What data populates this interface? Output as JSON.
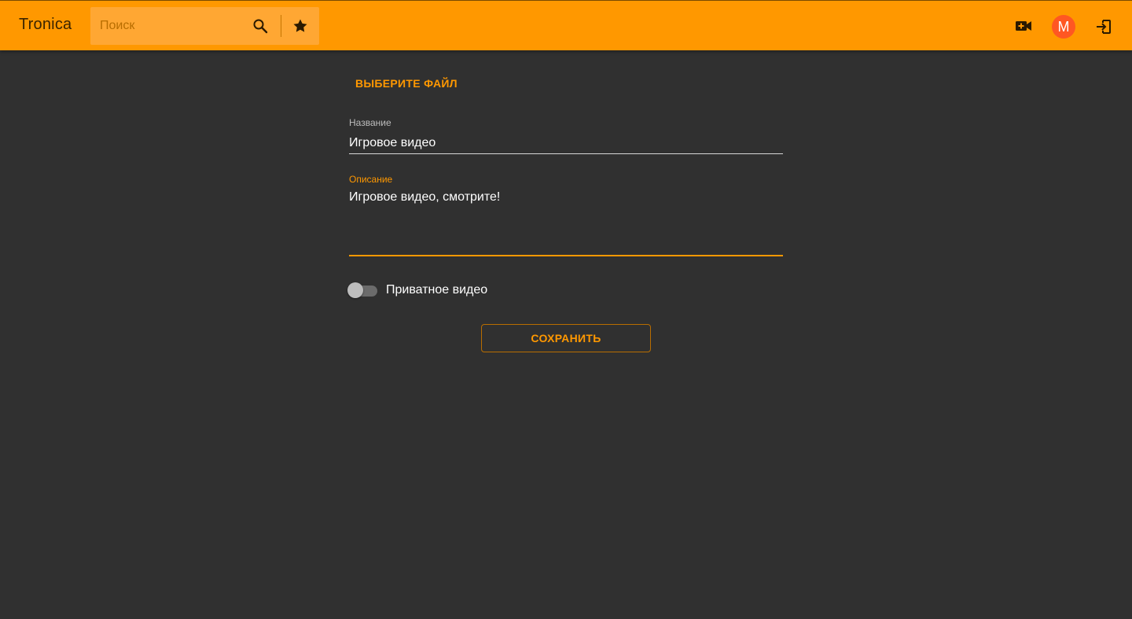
{
  "app": {
    "title": "Tronica"
  },
  "header": {
    "search_placeholder": "Поиск",
    "search_value": "",
    "avatar_initial": "M",
    "icons": [
      "search-icon",
      "star-icon",
      "video-add-icon",
      "logout-icon"
    ]
  },
  "form": {
    "choose_file_label": "ВЫБЕРИТЕ ФАЙЛ",
    "name_label": "Название",
    "name_value": "Игровое видео",
    "description_label": "Описание",
    "description_value": "Игровое видео, смотрите!",
    "private_label": "Приватное видео",
    "private_enabled": false,
    "save_label": "СОХРАНИТЬ"
  },
  "colors": {
    "accent": "#ff9800",
    "background": "#303030",
    "avatar": "#ff5722"
  }
}
